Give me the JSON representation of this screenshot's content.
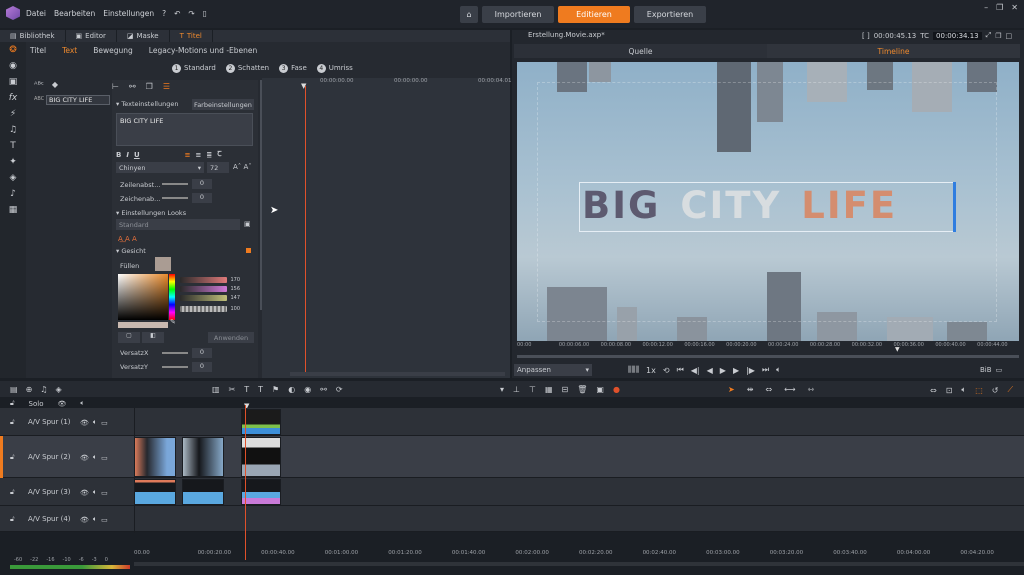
{
  "menu": [
    "Datei",
    "Bearbeiten",
    "Einstellungen"
  ],
  "top_buttons": {
    "import": "Importieren",
    "edit": "Editieren",
    "export": "Exportieren"
  },
  "left_tabs": [
    "Bibliothek",
    "Editor",
    "Maske",
    "Titel"
  ],
  "sub_tabs": [
    "Titel",
    "Text",
    "Bewegung",
    "Legacy-Motions und -Ebenen"
  ],
  "steps": [
    {
      "n": "1",
      "label": "Standard"
    },
    {
      "n": "2",
      "label": "Schatten"
    },
    {
      "n": "3",
      "label": "Fase"
    },
    {
      "n": "4",
      "label": "Umriss"
    }
  ],
  "layer": {
    "name": "BIG CITY LIFE"
  },
  "props": {
    "text_settings": "Texteinstellungen",
    "color_settings": "Farbeinstellungen",
    "text_value": "BIG CITY LIFE",
    "font": "Chinyen",
    "size": "72",
    "line_spacing": "Zeilenabst...",
    "char_spacing": "Zeichenab...",
    "looks": "Einstellungen Looks",
    "look_value": "Standard",
    "face": "Gesicht",
    "fill": "Füllen",
    "rgb": [
      "170",
      "156",
      "147"
    ],
    "alpha": "100",
    "apply": "Anwenden",
    "offset_x": "VersatzX",
    "offset_y": "VersatzY",
    "zero": "0"
  },
  "title_timeline": {
    "ticks": [
      "00:00:00.00",
      "00:00:00.00",
      "00:00:04.01"
    ]
  },
  "preview": {
    "project": "Erstellung.Movie.axp*",
    "duration": "00:00:45.13",
    "tc_label": "TC",
    "tc": "00:00:34.13",
    "source": "Quelle",
    "timeline": "Timeline",
    "fit": "Anpassen",
    "speed": "1x",
    "pip": "BiB",
    "ruler": [
      "00:00",
      "00:00:06.00",
      "00:00:08.00",
      "00:00:12.00",
      "00:00:16.00",
      "00:00:20.00",
      "00:00:24.00",
      "00:00:28.00",
      "00:00:32.00",
      "00:00:36.00",
      "00:00:40.00",
      "00:00:44.00"
    ]
  },
  "title_words": [
    {
      "text": "BIG",
      "color": "#5d5a70"
    },
    {
      "text": "CITY",
      "color": "#d8dde0"
    },
    {
      "text": "LIFE",
      "color": "#d48d6f"
    }
  ],
  "timeline": {
    "solo": "Solo",
    "tracks": [
      "A/V Spur (1)",
      "A/V Spur (2)",
      "A/V Spur (3)",
      "A/V Spur (4)"
    ],
    "ruler": [
      "00.00",
      "00:00:20.00",
      "00:00:40.00",
      "00:01:00.00",
      "00:01:20.00",
      "00:01:40.00",
      "00:02:00.00",
      "00:02:20.00",
      "00:02:40.00",
      "00:03:00.00",
      "00:03:20.00",
      "00:03:40.00",
      "00:04:00.00",
      "00:04:20.00"
    ],
    "meter": [
      "-60",
      "-22",
      "-16",
      "-10",
      "-6",
      "-3",
      "0"
    ]
  },
  "accent": "#ef7b1f"
}
